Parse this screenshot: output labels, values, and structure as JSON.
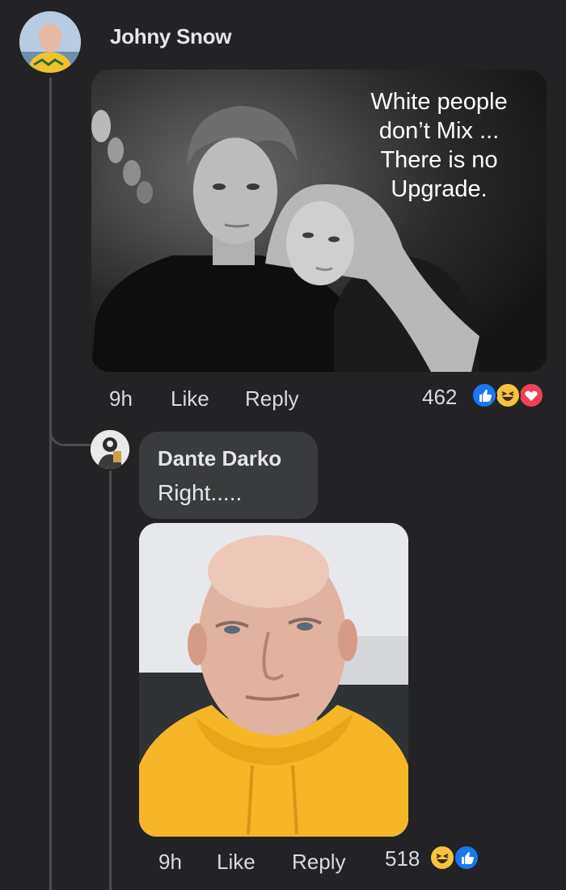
{
  "comment": {
    "author": "Johny Snow",
    "image_text": "White people\ndon’t Mix ...\nThere is no\nUpgrade.",
    "time": "9h",
    "like_label": "Like",
    "reply_label": "Reply",
    "reaction_count": "462",
    "reactions": [
      "like-icon",
      "haha-icon",
      "love-icon"
    ]
  },
  "reply": {
    "author": "Dante Darko",
    "text": "Right.....",
    "time": "9h",
    "like_label": "Like",
    "reply_label": "Reply",
    "reaction_count": "518",
    "reactions": [
      "haha-icon",
      "like-icon"
    ]
  },
  "colors": {
    "background": "#232325",
    "bubble": "#3a3b3c",
    "text": "#e4e6eb",
    "like_blue": "#1877f2",
    "haha_yellow": "#f7c33f",
    "love_red": "#f33e58"
  }
}
